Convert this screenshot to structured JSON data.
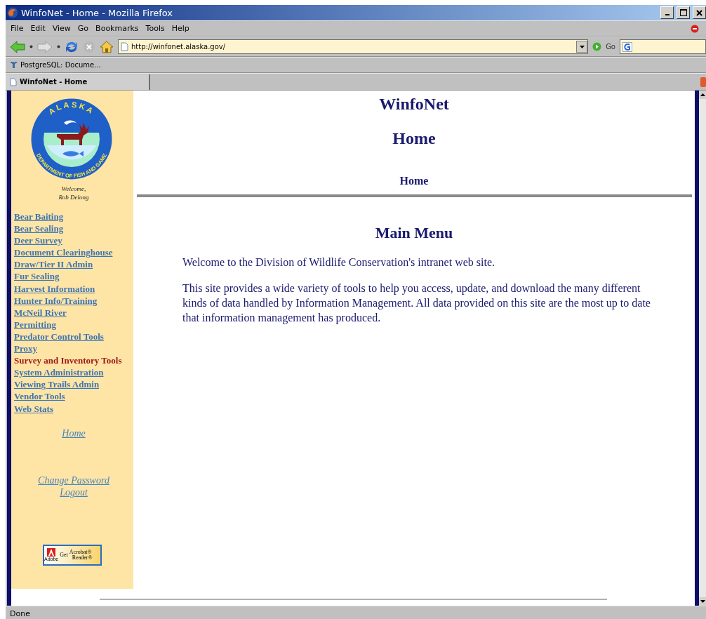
{
  "window": {
    "title": "WinfoNet - Home - Mozilla Firefox"
  },
  "menu_bar": [
    "File",
    "Edit",
    "View",
    "Go",
    "Bookmarks",
    "Tools",
    "Help"
  ],
  "address_bar": {
    "value": "http://winfonet.alaska.gov/"
  },
  "go_button": "Go",
  "bookmarks": [
    "PostgreSQL: Docume..."
  ],
  "tabs": [
    {
      "label": "WinfoNet - Home",
      "selected": true
    }
  ],
  "sidebar": {
    "logo": {
      "top": "ALASKA",
      "ring": "DEPARTMENT OF FISH AND GAME"
    },
    "welcome": [
      "Welcome,",
      "Rob Delong"
    ],
    "items": [
      {
        "label": "Bear Baiting",
        "selected": false
      },
      {
        "label": "Bear Sealing",
        "selected": false
      },
      {
        "label": "Deer Survey",
        "selected": false
      },
      {
        "label": "Document Clearinghouse",
        "selected": false
      },
      {
        "label": "Draw/Tier II Admin",
        "selected": false
      },
      {
        "label": "Fur Sealing",
        "selected": false
      },
      {
        "label": "Harvest Information",
        "selected": false
      },
      {
        "label": "Hunter Info/Training",
        "selected": false
      },
      {
        "label": "McNeil River",
        "selected": false
      },
      {
        "label": "Permitting",
        "selected": false
      },
      {
        "label": "Predator Control Tools",
        "selected": false
      },
      {
        "label": "Proxy",
        "selected": false
      },
      {
        "label": "Survey and Inventory Tools",
        "selected": true
      },
      {
        "label": "System Administration",
        "selected": false
      },
      {
        "label": "Viewing Trails Admin",
        "selected": false
      },
      {
        "label": "Vendor Tools",
        "selected": false
      },
      {
        "label": "Web Stats",
        "selected": false
      }
    ],
    "home_link": "Home",
    "account_links": [
      "Change Password",
      "Logout"
    ],
    "acrobat_badge": {
      "maker": "Adobe",
      "get": "Get",
      "product": "Acrobat®",
      "subproduct": "Reader®"
    }
  },
  "page": {
    "site_title": "WinfoNet",
    "page_title": "Home",
    "breadcrumb": "Home",
    "section_title": "Main Menu",
    "paragraphs": [
      "Welcome to the Division of Wildlife Conservation's intranet web site.",
      "This site provides a wide variety of tools to help you access, update, and download the many different kinds of data handled by Information Management. All data provided on this site are the most up to date that information management has produced."
    ]
  },
  "status_bar": {
    "text": "Done"
  }
}
